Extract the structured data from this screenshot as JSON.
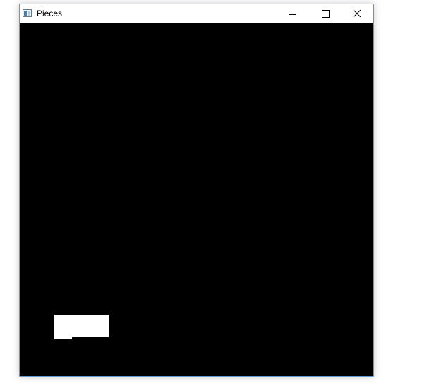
{
  "window": {
    "title": "Pieces",
    "app_icon": "window-app-icon",
    "controls": {
      "minimize_icon": "minimize-icon",
      "maximize_icon": "maximize-icon",
      "close_icon": "close-icon"
    }
  },
  "canvas": {
    "background": "#000000",
    "piece_color": "#ffffff"
  },
  "colors": {
    "window_border": "#5b9bd5",
    "titlebar": "#ffffff"
  }
}
